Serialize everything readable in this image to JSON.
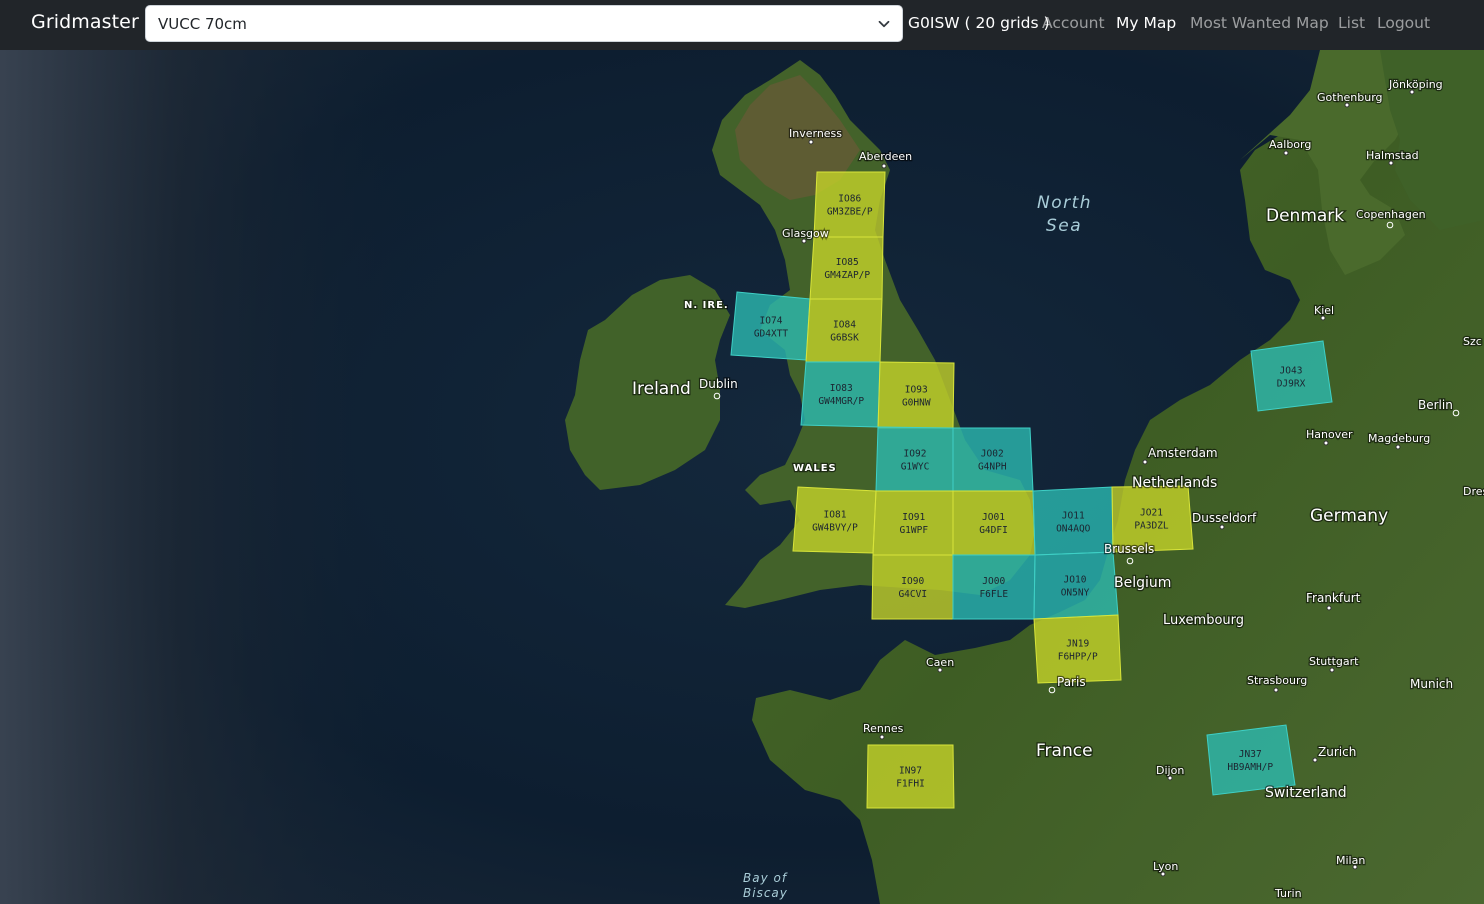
{
  "navbar": {
    "brand": "Gridmaster",
    "select": {
      "value": "VUCC 70cm"
    },
    "callsign_info": "G0ISW ( 20 grids )",
    "links": [
      {
        "label": "Account",
        "active": false
      },
      {
        "label": "My Map",
        "active": true
      },
      {
        "label": "Most Wanted Map",
        "active": false
      },
      {
        "label": "List",
        "active": false
      },
      {
        "label": "Logout",
        "active": false
      }
    ]
  },
  "map": {
    "colors": {
      "worked": "#c8d629",
      "confirmed": "#2bbdb3",
      "sea": "#0f2033",
      "land": "#3f5e25"
    },
    "labels": {
      "countries": [
        "Ireland",
        "Denmark",
        "Netherlands",
        "Germany",
        "Belgium",
        "Luxembourg",
        "France",
        "Switzerland"
      ],
      "regions": [
        "N. IRE.",
        "WALES"
      ],
      "seas": [
        "North",
        "Sea",
        "Bay of",
        "Biscay"
      ],
      "cities": [
        "Inverness",
        "Aberdeen",
        "Glasgow",
        "Dublin",
        "Amsterdam",
        "Dusseldorf",
        "Brussels",
        "Paris",
        "Caen",
        "Rennes",
        "Dijon",
        "Lyon",
        "Turin",
        "Milan",
        "Zurich",
        "Strasbourg",
        "Stuttgart",
        "Munich",
        "Frankfurt",
        "Hanover",
        "Magdeburg",
        "Berlin",
        "Kiel",
        "Copenhagen",
        "Halmstad",
        "Aalborg",
        "Gothenburg",
        "Jönköping",
        "Dres",
        "Szc"
      ]
    },
    "grids": [
      {
        "locator": "IO86",
        "call": "GM3ZBE/P",
        "status": "worked"
      },
      {
        "locator": "IO85",
        "call": "GM4ZAP/P",
        "status": "worked"
      },
      {
        "locator": "IO74",
        "call": "GD4XTT",
        "status": "confirmed"
      },
      {
        "locator": "IO84",
        "call": "G6BSK",
        "status": "worked"
      },
      {
        "locator": "IO83",
        "call": "GW4MGR/P",
        "status": "confirmed"
      },
      {
        "locator": "IO93",
        "call": "G0HNW",
        "status": "worked"
      },
      {
        "locator": "IO92",
        "call": "G1WYC",
        "status": "confirmed"
      },
      {
        "locator": "JO02",
        "call": "G4NPH",
        "status": "confirmed"
      },
      {
        "locator": "IO81",
        "call": "GW4BVY/P",
        "status": "worked"
      },
      {
        "locator": "IO91",
        "call": "G1WPF",
        "status": "worked"
      },
      {
        "locator": "JO01",
        "call": "G4DFI",
        "status": "worked"
      },
      {
        "locator": "JO11",
        "call": "ON4AQO",
        "status": "confirmed"
      },
      {
        "locator": "JO21",
        "call": "PA3DZL",
        "status": "worked"
      },
      {
        "locator": "IO90",
        "call": "G4CVI",
        "status": "worked"
      },
      {
        "locator": "JO00",
        "call": "F6FLE",
        "status": "confirmed"
      },
      {
        "locator": "JO10",
        "call": "ON5NY",
        "status": "confirmed"
      },
      {
        "locator": "JN19",
        "call": "F6HPP/P",
        "status": "worked"
      },
      {
        "locator": "IN97",
        "call": "F1FHI",
        "status": "worked"
      },
      {
        "locator": "JO43",
        "call": "DJ9RX",
        "status": "confirmed"
      },
      {
        "locator": "JN37",
        "call": "HB9AMH/P",
        "status": "confirmed"
      }
    ]
  }
}
